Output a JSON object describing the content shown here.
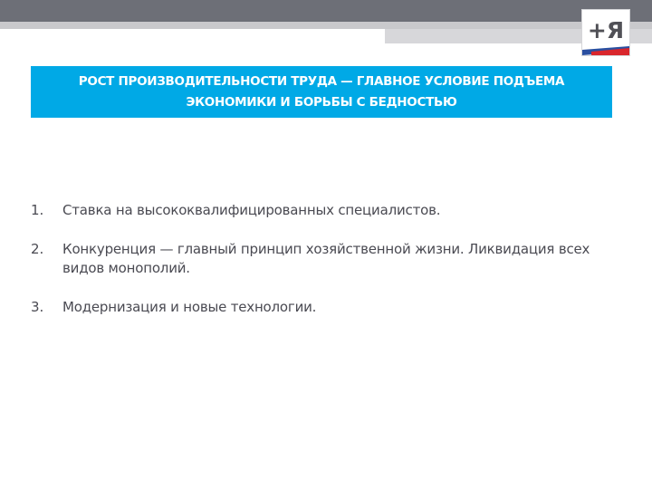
{
  "slide": {
    "title": "РОСТ ПРОИЗВОДИТЕЛЬНОСТИ ТРУДА — ГЛАВНОЕ УСЛОВИЕ ПОДЪЕМА ЭКОНОМИКИ И БОРЬБЫ С БЕДНОСТЬЮ",
    "items": [
      {
        "num": "1.",
        "text": "Ставка на высококвалифицированных специалистов."
      },
      {
        "num": "2.",
        "text": "Конкуренция — главный принцип хозяйственной жизни. Ликвидация всех видов монополий."
      },
      {
        "num": "3.",
        "text": "Модернизация и новые технологии."
      }
    ]
  },
  "logo": {
    "text": "+Я",
    "icon": "party-logo-icon"
  },
  "colors": {
    "accent": "#00a9e6",
    "top_bar": "#6d6f77",
    "body_text": "#4a4a52",
    "logo_text": "#505056",
    "flag_blue": "#2a4fa0",
    "flag_red": "#d9262c"
  }
}
